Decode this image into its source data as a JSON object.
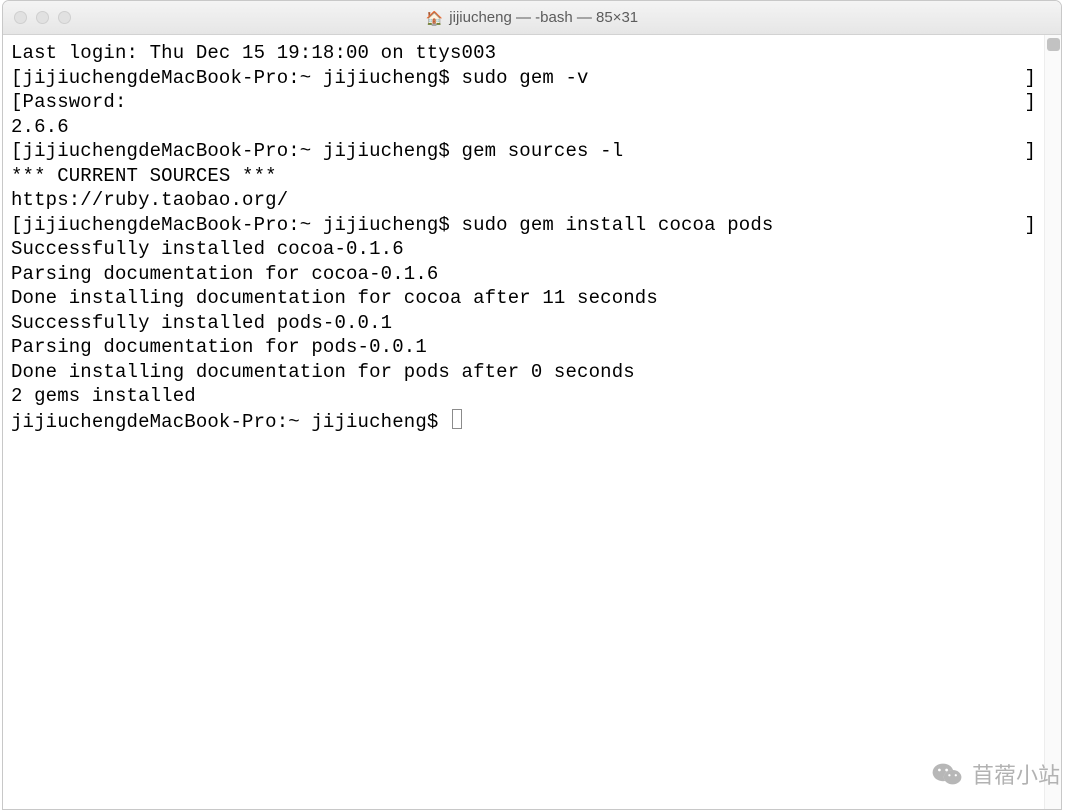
{
  "window": {
    "title": "jijiucheng — -bash — 85×31"
  },
  "terminal": {
    "prompt": "jijiuchengdeMacBook-Pro:~ jijiucheng$",
    "lines": [
      {
        "text": "Last login: Thu Dec 15 19:18:00 on ttys003",
        "bracket": false
      },
      {
        "text": "[jijiuchengdeMacBook-Pro:~ jijiucheng$ sudo gem -v",
        "bracket": true
      },
      {
        "text": "[Password:",
        "bracket": true
      },
      {
        "text": "2.6.6",
        "bracket": false
      },
      {
        "text": "[jijiuchengdeMacBook-Pro:~ jijiucheng$ gem sources -l",
        "bracket": true
      },
      {
        "text": "*** CURRENT SOURCES ***",
        "bracket": false
      },
      {
        "text": "",
        "bracket": false
      },
      {
        "text": "https://ruby.taobao.org/",
        "bracket": false
      },
      {
        "text": "[jijiuchengdeMacBook-Pro:~ jijiucheng$ sudo gem install cocoa pods",
        "bracket": true
      },
      {
        "text": "Successfully installed cocoa-0.1.6",
        "bracket": false
      },
      {
        "text": "Parsing documentation for cocoa-0.1.6",
        "bracket": false
      },
      {
        "text": "Done installing documentation for cocoa after 11 seconds",
        "bracket": false
      },
      {
        "text": "Successfully installed pods-0.0.1",
        "bracket": false
      },
      {
        "text": "Parsing documentation for pods-0.0.1",
        "bracket": false
      },
      {
        "text": "Done installing documentation for pods after 0 seconds",
        "bracket": false
      },
      {
        "text": "2 gems installed",
        "bracket": false
      }
    ],
    "current_prompt": "jijiuchengdeMacBook-Pro:~ jijiucheng$ "
  },
  "watermark": {
    "text": "苜蓿小站"
  }
}
